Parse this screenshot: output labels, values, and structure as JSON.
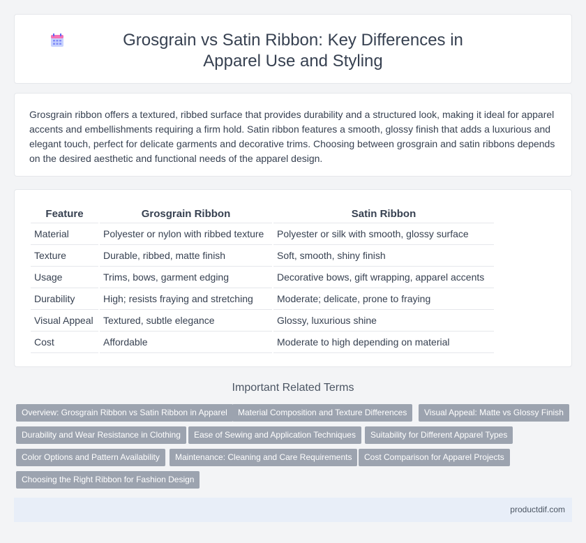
{
  "header": {
    "icon": "calendar-icon",
    "title": "Grosgrain vs Satin Ribbon: Key Differences in Apparel Use and Styling"
  },
  "intro": {
    "text": "Grosgrain ribbon offers a textured, ribbed surface that provides durability and a structured look, making it ideal for apparel accents and embellishments requiring a firm hold. Satin ribbon features a smooth, glossy finish that adds a luxurious and elegant touch, perfect for delicate garments and decorative trims. Choosing between grosgrain and satin ribbons depends on the desired aesthetic and functional needs of the apparel design."
  },
  "table": {
    "headers": [
      "Feature",
      "Grosgrain Ribbon",
      "Satin Ribbon"
    ],
    "rows": [
      [
        "Material",
        "Polyester or nylon with ribbed texture",
        "Polyester or silk with smooth, glossy surface"
      ],
      [
        "Texture",
        "Durable, ribbed, matte finish",
        "Soft, smooth, shiny finish"
      ],
      [
        "Usage",
        "Trims, bows, garment edging",
        "Decorative bows, gift wrapping, apparel accents"
      ],
      [
        "Durability",
        "High; resists fraying and stretching",
        "Moderate; delicate, prone to fraying"
      ],
      [
        "Visual Appeal",
        "Textured, subtle elegance",
        "Glossy, luxurious shine"
      ],
      [
        "Cost",
        "Affordable",
        "Moderate to high depending on material"
      ]
    ]
  },
  "related": {
    "title": "Important Related Terms",
    "tags": [
      "Overview: Grosgrain Ribbon vs Satin Ribbon in Apparel",
      "Material Composition and Texture Differences",
      "Visual Appeal: Matte vs Glossy Finish",
      "Durability and Wear Resistance in Clothing",
      "Ease of Sewing and Application Techniques",
      "Suitability for Different Apparel Types",
      "Color Options and Pattern Availability",
      "Maintenance: Cleaning and Care Requirements",
      "Cost Comparison for Apparel Projects",
      "Choosing the Right Ribbon for Fashion Design"
    ]
  },
  "footer": {
    "site": "productdif.com"
  },
  "colors": {
    "background": "#f3f4f6",
    "card": "#ffffff",
    "tag": "#9ca3af",
    "footer": "#e8eef8",
    "icon_accent": "#7c8cdb"
  }
}
